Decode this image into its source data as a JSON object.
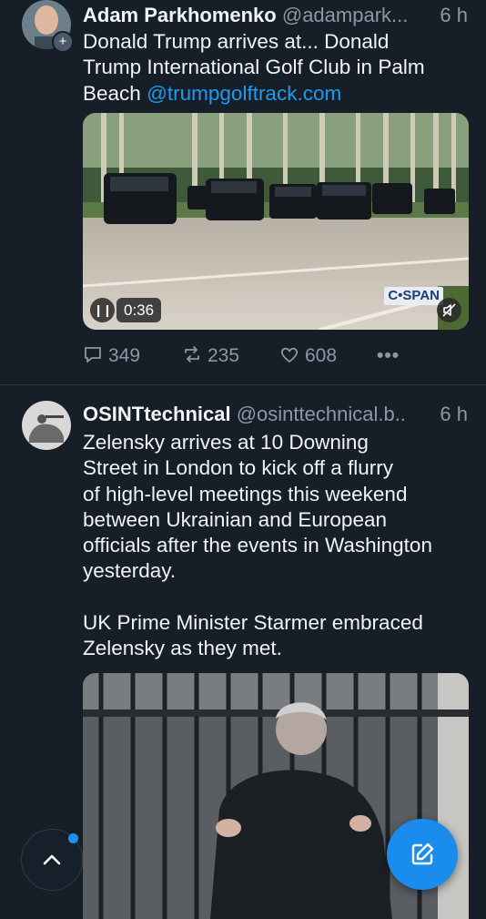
{
  "posts": [
    {
      "author": {
        "name": "Adam Parkhomenko",
        "handle": "@adampark...",
        "time": "6 h"
      },
      "text": "Donald Trump arrives at... Donald\nTrump International Golf Club in Palm\nBeach ",
      "link": "@trumpgolftrack.com",
      "video": {
        "duration": "0:36",
        "watermark": "C•SPAN",
        "pause_icon": "pause-icon",
        "mute_icon": "volume-off-icon"
      },
      "actions": {
        "replies": "349",
        "reposts": "235",
        "likes": "608",
        "more": "•••"
      }
    },
    {
      "author": {
        "name": "OSINTtechnical",
        "handle": "@osinttechnical.b..",
        "time": "6 h"
      },
      "text": "Zelensky arrives at 10 Downing\nStreet in London to kick off a flurry\nof high-level meetings this weekend\nbetween Ukrainian and European\nofficials after the events in Washington\nyesterday.\n\nUK Prime Minister Starmer embraced\nZelensky as they met."
    }
  ],
  "fab": {
    "scroll_up_icon": "chevron-up-icon",
    "compose_icon": "compose-icon"
  },
  "colors": {
    "background": "#161e27",
    "accent": "#1d9bf0",
    "muted": "#8b98a5",
    "text": "#f1f3f5"
  }
}
